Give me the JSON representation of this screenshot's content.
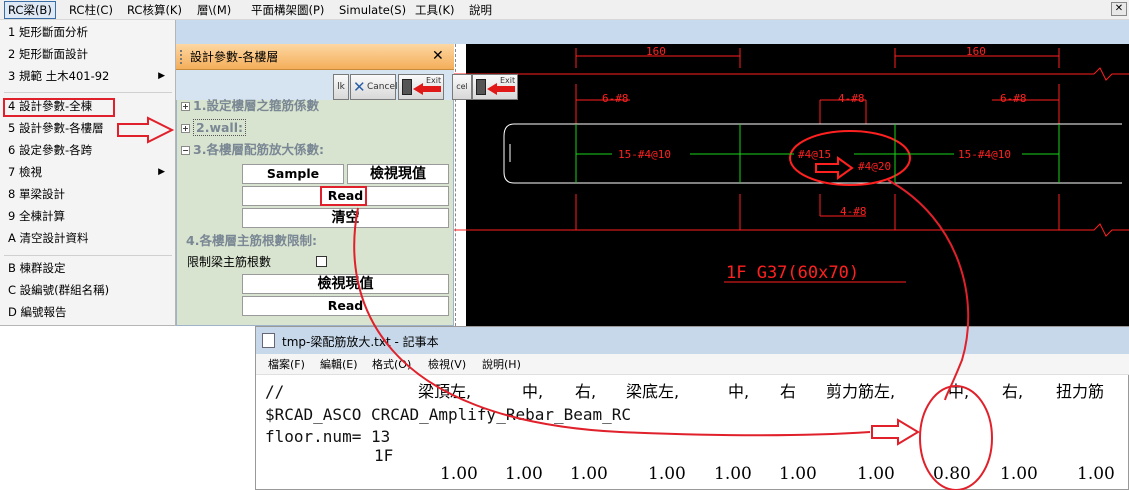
{
  "menubar": {
    "items": [
      "RC梁(B)",
      "RC柱(C)",
      "RC核算(K)",
      "層\\(M)",
      "平面構架圖(P)",
      "Simulate(S)",
      "工具(K)",
      "說明"
    ],
    "close_label": "✕"
  },
  "dropdown": {
    "items": [
      "1 矩形斷面分析",
      "2 矩形斷面設計",
      "3 規範 土木401-92",
      "4 設計參數-全棟",
      "5 設計參數-各樓層",
      "6 設定參數-各跨",
      "7 檢視",
      "8 單梁設計",
      "9 全棟計算",
      "A 清空設計資料",
      "B 棟群設定",
      "C 設編號(群組名稱)",
      "D 編號報告"
    ],
    "submenu_arrow": "▶"
  },
  "panel": {
    "title": "設計參數-各樓層",
    "close": "✕",
    "toolbar": {
      "ok": "lk",
      "cancel": "Cancel",
      "exit": "Exit",
      "cancel2": "cel",
      "exit2": "Exit"
    },
    "section1": "1.設定樓層之箍筋係數",
    "section2": "2.wall:",
    "section3": "3.各樓層配筋放大係數:",
    "sample": "Sample",
    "view_current": "檢視現值",
    "read": "Read",
    "clear": "清空",
    "section4": "4.各樓層主筋根數限制:",
    "limit_label": "限制梁主筋根數",
    "view_current2": "檢視現值",
    "read2": "Read",
    "expand": "+",
    "collapse": "−"
  },
  "cad": {
    "dim_top_left": "160",
    "dim_top_right": "160",
    "label_6_8_left": "6-#8",
    "label_4_8_top": "4-#8",
    "label_6_8_right": "6-#8",
    "label_15_4_10_left": "15-#4@10",
    "label_4_15": "#4@15",
    "label_4_20": "#4@20",
    "label_15_4_10_right": "15-#4@10",
    "label_4_8_bottom": "4-#8",
    "beam_title": "1F G37(60x70)",
    "colors": {
      "red": "#ff2020",
      "green": "#19d219",
      "white": "#ffffff"
    }
  },
  "notepad": {
    "title": "tmp-梁配筋放大.txt - 記事本",
    "menu": [
      "檔案(F)",
      "編輯(E)",
      "格式(O)",
      "檢視(V)",
      "說明(H)"
    ],
    "comment_prefix": "//",
    "headers": [
      "梁頂左,",
      "中,",
      "右,",
      "梁底左,",
      "中,",
      "右",
      "剪力筋左,",
      "中,",
      "右,",
      "扭力筋"
    ],
    "line2": "$RCAD_ASCO CRCAD_Amplify_Rebar_Beam_RC",
    "line3": "floor.num= 13",
    "line4": "1F",
    "values": [
      "1.00",
      "1.00",
      "1.00",
      "1.00",
      "1.00",
      "1.00",
      "1.00",
      "0.80",
      "1.00",
      "1.00"
    ]
  },
  "annotation_color": "#e0202a"
}
